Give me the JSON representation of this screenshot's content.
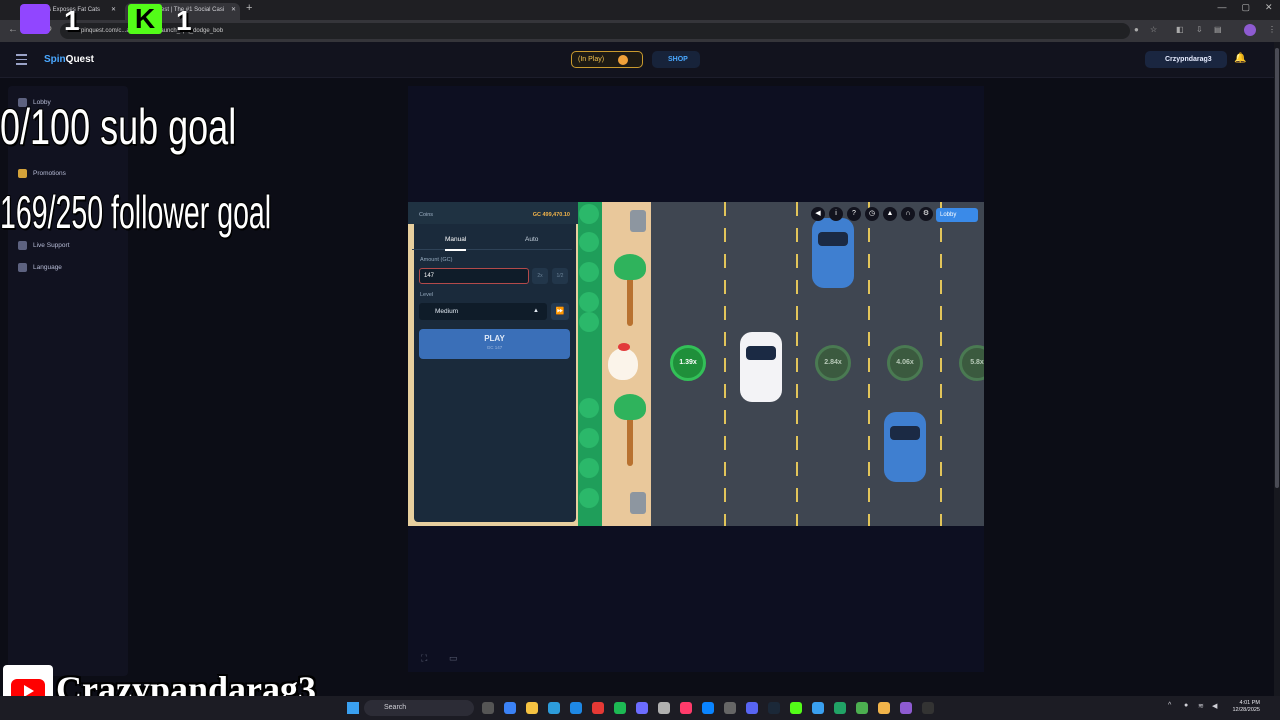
{
  "browser": {
    "tabs": [
      {
        "title": "Jon Ross Exposes Fat Cats"
      },
      {
        "title": "SpinQuest | The #1 Social Casi"
      }
    ],
    "url": "spinquest.com/c...am/ico...21_launch_spq_dodge_bob"
  },
  "header": {
    "logo_spin": "Spin",
    "logo_quest": "Quest",
    "inplay_label": "(In Play)",
    "shop_label": "SHOP",
    "username": "Crzypndarag3"
  },
  "sidebar": {
    "items": [
      {
        "label": "Lobby"
      },
      {
        "label": "Promotions"
      },
      {
        "label": "Live Support"
      },
      {
        "label": "Language"
      }
    ]
  },
  "overlay": {
    "sub_goal": "0/100 sub goal",
    "follower_goal": "169/250 follower goal",
    "twitch_count": "1",
    "kick_count": "1",
    "kick_letter": "K",
    "channel_name": "Crazypandarag3"
  },
  "game": {
    "coins_label": "Coins",
    "coins_value": "GC 499,470.10",
    "modes": [
      "Manual",
      "Auto"
    ],
    "amount_label": "Amount (GC)",
    "amount_value": "147",
    "half_label": "1/2",
    "double_label": "2x",
    "level_label": "Level",
    "level_value": "Medium",
    "play_label": "PLAY",
    "play_sub": "GC 147",
    "lobby_label": "Lobby",
    "multipliers": [
      "1.39x",
      "2.84x",
      "4.06x",
      "5.8x"
    ]
  },
  "taskbar": {
    "search_label": "Search",
    "time": "4:01 PM",
    "date": "12/28/2025"
  }
}
